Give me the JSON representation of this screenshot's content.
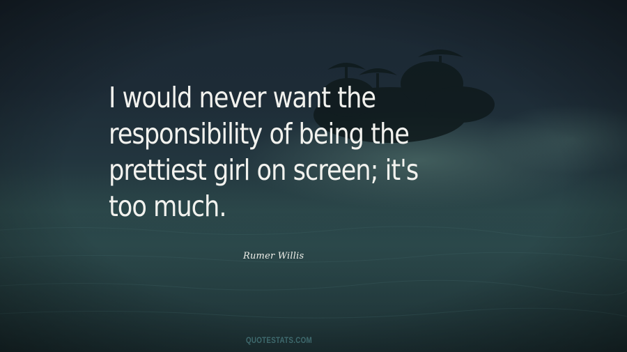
{
  "quote": {
    "lines": [
      "I would never want the",
      "responsibility of being the",
      "prettiest girl on screen; it's",
      "too much."
    ]
  },
  "author": "Rumer Willis",
  "watermark": "QUOTESTATS.COM",
  "colors": {
    "text": "#f2f2ee",
    "background": "#1d2b36",
    "water": "#2a4447",
    "watermark": "#3f6a6e"
  }
}
